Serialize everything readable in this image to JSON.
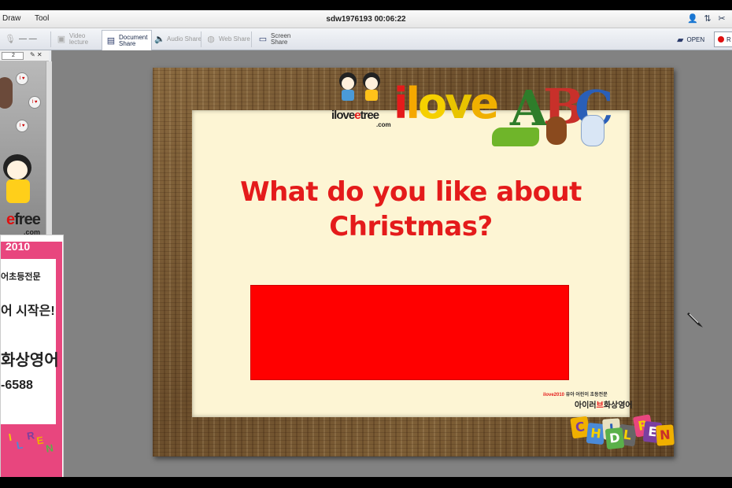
{
  "menu": {
    "items": [
      "Draw",
      "Tool"
    ],
    "session_title": "sdw1976193 00:06:22"
  },
  "toolbar": {
    "items": [
      {
        "label": "Video\nlecture",
        "icon": "video-camera-icon",
        "state": "disabled"
      },
      {
        "label": "Document\nShare",
        "icon": "document-icon",
        "state": "active"
      },
      {
        "label": "Audio Share",
        "icon": "speaker-icon",
        "state": "disabled"
      },
      {
        "label": "Web Share",
        "icon": "globe-icon",
        "state": "disabled"
      },
      {
        "label": "Screen\nShare",
        "icon": "monitor-icon",
        "state": "disabled"
      }
    ],
    "open_label": "OPEN",
    "record_label": "R"
  },
  "left_panel": {
    "page_select_value": "2",
    "video_text": {
      "brand": "free",
      "domain": ".com",
      "badge": "I ♥"
    }
  },
  "ad": {
    "year": "2010",
    "lines": [
      "어초등전문",
      "어 시작은!",
      "화상영어",
      "-6588"
    ],
    "letters": [
      "I",
      "L",
      "R",
      "E",
      "N"
    ]
  },
  "slide": {
    "logo_prefix": "ilove",
    "logo_mid": "e",
    "logo_suffix": "tree",
    "logo_domain": ".com",
    "headline_letters": [
      "i",
      "l",
      "o",
      "v",
      "e"
    ],
    "abc_letters": [
      "A",
      "B",
      "C"
    ],
    "question_line1": "What do you like about",
    "question_line2": "Christmas?",
    "brand_small": "유아 어린이 초등전문",
    "brand_small_year": "ilove2010",
    "brand_big_pre": "아이러",
    "brand_big_heart": "브",
    "brand_big_post": "화상영어",
    "children_letters": [
      "C",
      "H",
      "I",
      "L",
      "D",
      "R",
      "E",
      "N"
    ]
  },
  "colors": {
    "accent_red": "#e41b1b",
    "answer_box": "#ff0000",
    "board": "#fdf5d4",
    "canvas_bg": "#828282",
    "ad_pink": "#e8467e"
  }
}
